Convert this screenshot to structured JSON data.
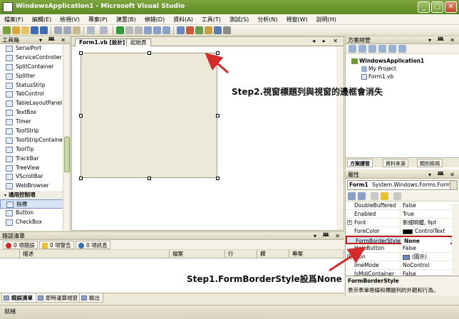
{
  "window": {
    "title": "WindowsApplication1 - Microsoft Visual Studio",
    "min": "_",
    "max": "□",
    "close": "✕"
  },
  "menu": [
    "檔案(F)",
    "編輯(E)",
    "檢視(V)",
    "專案(P)",
    "建置(B)",
    "偵錯(D)",
    "資料(A)",
    "工具(T)",
    "測試(S)",
    "分析(N)",
    "視窗(W)",
    "說明(H)"
  ],
  "toolbox": {
    "title": "工具箱",
    "controls": "▾ ᚙ ✕",
    "items": [
      "SerialPort",
      "ServiceController",
      "SplitContainer",
      "Splitter",
      "StatusStrip",
      "TabControl",
      "TableLayoutPanel",
      "TextBox",
      "Timer",
      "ToolStrip",
      "ToolStripContainer",
      "ToolTip",
      "TrackBar",
      "TreeView",
      "VScrollBar",
      "WebBrowser"
    ],
    "group": "通用控制項",
    "group_items": [
      "指標",
      "Button",
      "CheckBox"
    ]
  },
  "designer": {
    "tabs": [
      {
        "label": "Form1.vb [設計]"
      },
      {
        "label": "起始頁"
      }
    ],
    "tab_controls": "◂ ▸ ✕"
  },
  "solution_explorer": {
    "title": "方案總管",
    "controls": "▾ ᚙ ✕",
    "solution": "WindowsApplication1",
    "items": [
      "My Project",
      "Form1.vb"
    ],
    "tabs": [
      "方案總管",
      "資料來源",
      "類別檢視"
    ]
  },
  "properties": {
    "title": "屬性",
    "controls": "▾ ᚙ ✕",
    "object": "Form1",
    "object_type": "System.Windows.Forms.Form",
    "rows": [
      {
        "name": "DoubleBuffered",
        "value": "False"
      },
      {
        "name": "Enabled",
        "value": "True"
      },
      {
        "name": "Font",
        "value": "新細明體, 9pt"
      },
      {
        "name": "ForeColor",
        "value": "ControlText"
      },
      {
        "name": "FormBorderStyle",
        "value": "None"
      },
      {
        "name": "HelpButton",
        "value": "False"
      },
      {
        "name": "Icon",
        "value": "(圖示)"
      },
      {
        "name": "ImeMode",
        "value": "NoControl"
      },
      {
        "name": "IsMdiContainer",
        "value": "False"
      }
    ],
    "desc_title": "FormBorderStyle",
    "desc_text": "表示表單框線和標題列的外觀和行為。"
  },
  "error_list": {
    "title": "錯誤清單",
    "controls": "▾ ᚙ ✕",
    "filters": [
      "0 項錯誤",
      "0 項警告",
      "0 項訊息"
    ],
    "columns": [
      "描述",
      "檔案",
      "行",
      "欄",
      "專案"
    ]
  },
  "bottom_tabs": [
    "錯誤清單",
    "即時運算視窗",
    "輸出"
  ],
  "status": "就緒",
  "annotations": {
    "step1": "Step1.FormBorderStyle設爲None",
    "step2": "Step2.視窗標題列與視窗的邊框會消失"
  },
  "colors": {
    "annotation_arrow": "#D42A2A",
    "title_bar": "#6F9A34",
    "highlight_border": "#C41919"
  }
}
